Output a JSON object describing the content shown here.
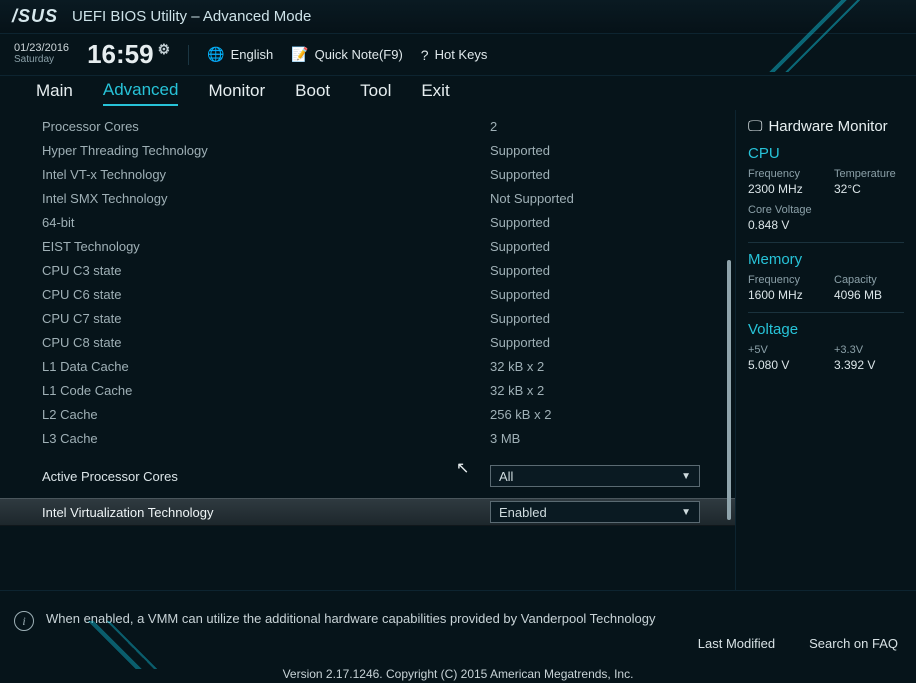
{
  "header": {
    "brand": "/SUS",
    "title": "UEFI BIOS Utility – Advanced Mode"
  },
  "datetime": {
    "date": "01/23/2016",
    "day": "Saturday",
    "time": "16:59"
  },
  "topbar": {
    "language": "English",
    "quicknote": "Quick Note(F9)",
    "hotkeys": "Hot Keys"
  },
  "menu": [
    "Main",
    "Advanced",
    "Monitor",
    "Boot",
    "Tool",
    "Exit"
  ],
  "menu_active": 1,
  "rows": [
    {
      "label": "Processor Cores",
      "value": "2"
    },
    {
      "label": "Hyper Threading  Technology",
      "value": "Supported"
    },
    {
      "label": "Intel VT-x Technology",
      "value": "Supported"
    },
    {
      "label": "Intel SMX Technology",
      "value": "Not Supported"
    },
    {
      "label": "64-bit",
      "value": "Supported"
    },
    {
      "label": "EIST Technology",
      "value": "Supported"
    },
    {
      "label": "CPU C3 state",
      "value": "Supported"
    },
    {
      "label": "CPU C6 state",
      "value": "Supported"
    },
    {
      "label": "CPU C7 state",
      "value": "Supported"
    },
    {
      "label": "CPU C8 state",
      "value": "Supported"
    },
    {
      "label": "L1 Data Cache",
      "value": "32 kB x 2"
    },
    {
      "label": "L1 Code Cache",
      "value": "32 kB x 2"
    },
    {
      "label": "L2 Cache",
      "value": "256 kB x 2"
    },
    {
      "label": "L3 Cache",
      "value": "3 MB"
    }
  ],
  "form": {
    "active_cores": {
      "label": "Active Processor Cores",
      "value": "All"
    },
    "vtx": {
      "label": "Intel Virtualization Technology",
      "value": "Enabled"
    }
  },
  "help": "When enabled, a VMM can utilize the additional hardware capabilities provided by Vanderpool Technology",
  "side": {
    "title": "Hardware Monitor",
    "cpu": {
      "heading": "CPU",
      "freq_k": "Frequency",
      "freq_v": "2300 MHz",
      "temp_k": "Temperature",
      "temp_v": "32°C",
      "cv_k": "Core Voltage",
      "cv_v": "0.848 V"
    },
    "mem": {
      "heading": "Memory",
      "freq_k": "Frequency",
      "freq_v": "1600 MHz",
      "cap_k": "Capacity",
      "cap_v": "4096 MB"
    },
    "volt": {
      "heading": "Voltage",
      "v5_k": "+5V",
      "v5_v": "5.080 V",
      "v33_k": "+3.3V",
      "v33_v": "3.392 V"
    }
  },
  "footer": {
    "last_modified": "Last Modified",
    "faq": "Search on FAQ",
    "version": "Version 2.17.1246. Copyright (C) 2015 American Megatrends, Inc."
  }
}
